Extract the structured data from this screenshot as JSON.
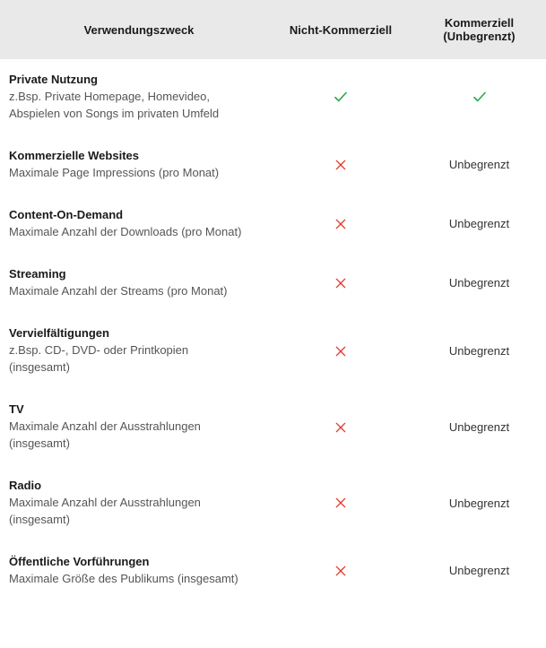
{
  "header": {
    "col1": "Verwendungszweck",
    "col2": "Nicht-Kommerziell",
    "col3": "Kommerziell (Unbegrenzt)"
  },
  "rows": [
    {
      "title": "Private Nutzung",
      "sub": "z.Bsp. Private Homepage, Homevideo, Abspielen von Songs im privaten Umfeld",
      "nc": "check",
      "kc": "check"
    },
    {
      "title": "Kommerzielle Websites",
      "sub": "Maximale Page Impressions (pro Monat)",
      "nc": "cross",
      "kc": "Unbegrenzt"
    },
    {
      "title": "Content-On-Demand",
      "sub": "Maximale Anzahl der Downloads (pro Monat)",
      "nc": "cross",
      "kc": "Unbegrenzt"
    },
    {
      "title": "Streaming",
      "sub": "Maximale Anzahl der Streams (pro Monat)",
      "nc": "cross",
      "kc": "Unbegrenzt"
    },
    {
      "title": "Vervielfältigungen",
      "sub": "z.Bsp. CD-, DVD- oder Printkopien (insgesamt)",
      "nc": "cross",
      "kc": "Unbegrenzt"
    },
    {
      "title": "TV",
      "sub": "Maximale Anzahl der Ausstrahlungen (insgesamt)",
      "nc": "cross",
      "kc": "Unbegrenzt"
    },
    {
      "title": "Radio",
      "sub": "Maximale Anzahl der Ausstrahlungen (insgesamt)",
      "nc": "cross",
      "kc": "Unbegrenzt"
    },
    {
      "title": "Öffentliche Vorführungen",
      "sub": "Maximale Größe des Publikums (insgesamt)",
      "nc": "cross",
      "kc": "Unbegrenzt"
    }
  ],
  "chart_data": {
    "type": "table",
    "title": "Verwendungszweck",
    "columns": [
      "Verwendungszweck",
      "Nicht-Kommerziell",
      "Kommerziell (Unbegrenzt)"
    ],
    "rows": [
      [
        "Private Nutzung",
        "✓",
        "✓"
      ],
      [
        "Kommerzielle Websites",
        "✕",
        "Unbegrenzt"
      ],
      [
        "Content-On-Demand",
        "✕",
        "Unbegrenzt"
      ],
      [
        "Streaming",
        "✕",
        "Unbegrenzt"
      ],
      [
        "Vervielfältigungen",
        "✕",
        "Unbegrenzt"
      ],
      [
        "TV",
        "✕",
        "Unbegrenzt"
      ],
      [
        "Radio",
        "✕",
        "Unbegrenzt"
      ],
      [
        "Öffentliche Vorführungen",
        "✕",
        "Unbegrenzt"
      ]
    ]
  }
}
